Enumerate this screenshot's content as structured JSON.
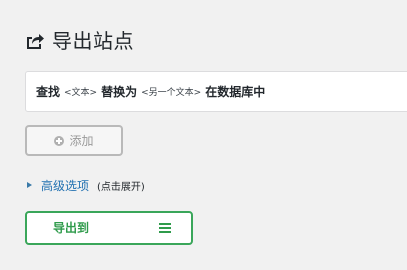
{
  "header": {
    "title": "导出站点",
    "icon": "export-icon"
  },
  "find_replace": {
    "find_label": "查找",
    "find_placeholder": "<文本>",
    "replace_label": "替换为",
    "replace_placeholder": "<另一个文本>",
    "scope_label": "在数据库中"
  },
  "actions": {
    "add_label": "添加",
    "add_icon": "plus-circle-icon"
  },
  "advanced": {
    "label": "高级选项",
    "hint": "(点击展开)",
    "icon": "triangle-right-icon"
  },
  "export": {
    "label": "导出到",
    "menu_icon": "hamburger-menu-icon"
  },
  "colors": {
    "green": "#2f9b4b",
    "link_blue": "#2271b1",
    "background": "#f1f1f1"
  }
}
